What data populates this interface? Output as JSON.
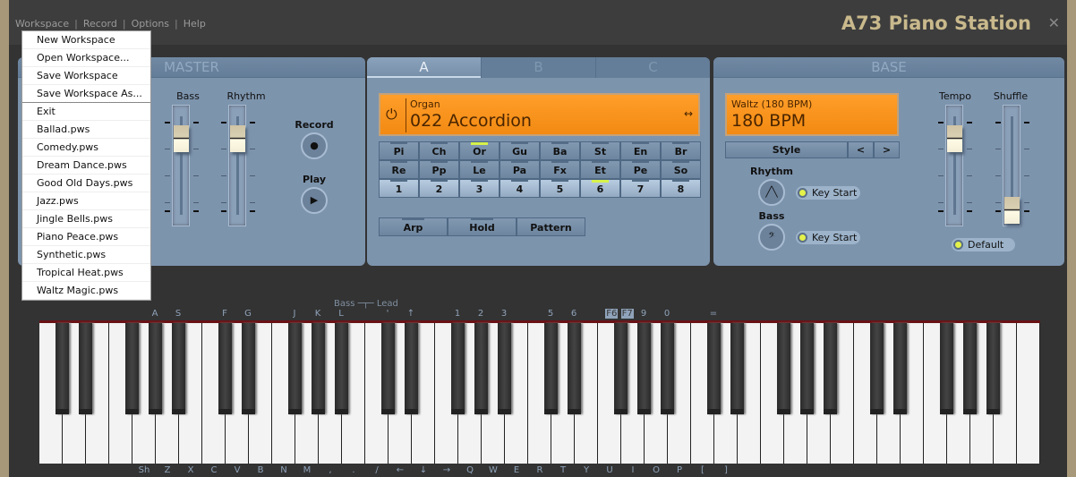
{
  "app": {
    "title": "A73 Piano Station",
    "close_icon": "close-icon"
  },
  "menubar": [
    "Workspace",
    "Record",
    "Options",
    "Help"
  ],
  "workspace_menu": {
    "items": [
      "New Workspace",
      "Open Workspace...",
      "Save Workspace",
      "Save Workspace As...",
      "Exit"
    ],
    "files": [
      "Ballad.pws",
      "Comedy.pws",
      "Dream Dance.pws",
      "Good Old Days.pws",
      "Jazz.pws",
      "Jingle Bells.pws",
      "Piano Peace.pws",
      "Synthetic.pws",
      "Tropical Heat.pws",
      "Waltz Magic.pws"
    ]
  },
  "master": {
    "title": "MASTER",
    "bass": "Bass",
    "rhythm": "Rhythm",
    "record": "Record",
    "play": "Play"
  },
  "voice": {
    "tabs": [
      "A",
      "B",
      "C"
    ],
    "active_tab": "A",
    "category": "Organ",
    "instrument": "022 Accordion",
    "row1": [
      "Pi",
      "Ch",
      "Or",
      "Gu",
      "Ba",
      "St",
      "En",
      "Br"
    ],
    "row2": [
      "Re",
      "Pp",
      "Le",
      "Pa",
      "Fx",
      "Et",
      "Pe",
      "So"
    ],
    "row3": [
      "1",
      "2",
      "3",
      "4",
      "5",
      "6",
      "7",
      "8"
    ],
    "active_row1": 2,
    "active_row3": 5,
    "modes": [
      "Arp",
      "Hold",
      "Pattern"
    ]
  },
  "base": {
    "title": "BASE",
    "style_name": "Waltz (180 BPM)",
    "bpm": "180 BPM",
    "style": "Style",
    "prev": "<",
    "next": ">",
    "rhythm": "Rhythm",
    "bass": "Bass",
    "key_start": "Key Start",
    "tempo": "Tempo",
    "shuffle": "Shuffle",
    "default": "Default"
  },
  "keyboard": {
    "split_label": "Bass ─┬─ Lead",
    "white_labels": [
      "Sh",
      "Z",
      "X",
      "C",
      "V",
      "B",
      "N",
      "M",
      ",",
      ".",
      "/",
      "←",
      "↓",
      "→",
      "Q",
      "W",
      "E",
      "R",
      "T",
      "Y",
      "U",
      "I",
      "O",
      "P",
      "[",
      "]"
    ],
    "black_labels": [
      "",
      "",
      "",
      "A",
      "S",
      "F",
      "G",
      "J",
      "K",
      "L",
      "'",
      "↑",
      "1",
      "2",
      "3",
      "5",
      "6",
      "",
      "9",
      "0",
      "="
    ],
    "f6": "F6",
    "f7": "F7"
  }
}
